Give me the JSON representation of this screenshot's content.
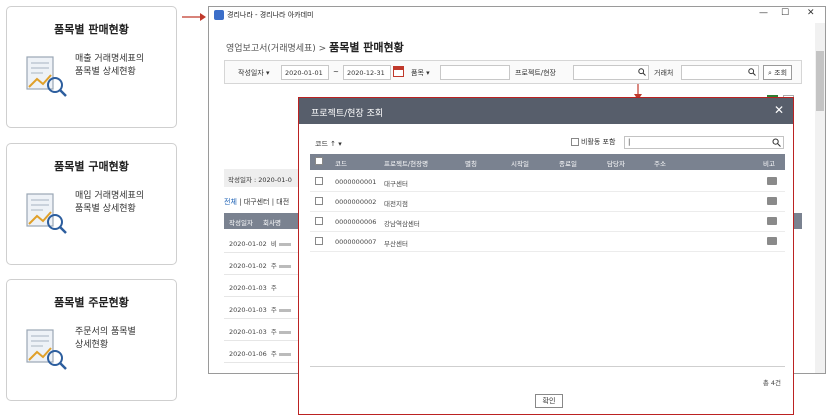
{
  "cards": [
    {
      "title": "품목별 판매현황",
      "desc": "매출 거래명세표의\n품목별 상세현황"
    },
    {
      "title": "품목별 구매현황",
      "desc": "매입 거래명세표의\n품목별 상세현황"
    },
    {
      "title": "품목별 주문현황",
      "desc": "주문서의 품목별\n상세현황"
    }
  ],
  "window": {
    "title": "경리나라 - 경리나라 아카데미",
    "breadcrumb_prefix": "영업보고서(거래명세표) > ",
    "breadcrumb_current": "품목별 판매현황"
  },
  "filters": {
    "date_label": "작성일자",
    "date_from": "2020-01-01",
    "date_sep": "~",
    "date_to": "2020-12-31",
    "item_label": "품목",
    "project_label": "프로젝트/현장",
    "client_label": "거래처",
    "search_label": "조회"
  },
  "background": {
    "summary": "작성일자 : 2020-01-0",
    "tabs": [
      "전체",
      "대구센터",
      "대전"
    ],
    "col_date": "작성일자",
    "col_company": "회사명",
    "rows": [
      {
        "date": "2020-01-02",
        "company": "비"
      },
      {
        "date": "2020-01-02",
        "company": "주"
      },
      {
        "date": "2020-01-03",
        "company": "주"
      },
      {
        "date": "2020-01-03",
        "company": "주"
      },
      {
        "date": "2020-01-03",
        "company": "주"
      },
      {
        "date": "2020-01-06",
        "company": "주"
      }
    ]
  },
  "modal": {
    "title": "프로젝트/현장 조회",
    "code_sort": "코드 ↑ ▾",
    "include_inactive": "비활동 포함",
    "search_value": "|",
    "columns": {
      "code": "코드",
      "name": "프로젝트/현장명",
      "type": "별칭",
      "start": "시작일",
      "end": "종료일",
      "manager": "담당자",
      "address": "주소",
      "note": "비고"
    },
    "rows": [
      {
        "code": "0000000001",
        "name": "대구센터"
      },
      {
        "code": "0000000002",
        "name": "대전지점"
      },
      {
        "code": "0000000006",
        "name": "강남역삼센터"
      },
      {
        "code": "0000000007",
        "name": "부산센터"
      }
    ],
    "total": "총 4건",
    "confirm": "확인"
  },
  "colors": {
    "accent_red": "#c0392b",
    "header_gray": "#7a8290",
    "modal_head": "#575e6b",
    "link_blue": "#1a5fb4"
  }
}
